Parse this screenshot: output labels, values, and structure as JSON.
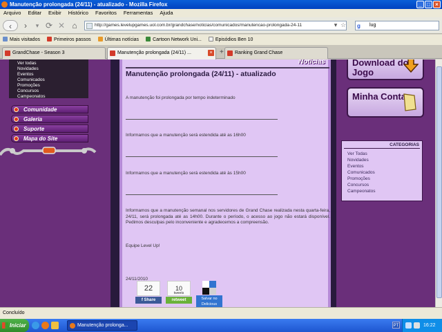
{
  "window": {
    "title": "Manutenção prolongada (24/11) - atualizado - Mozilla Firefox"
  },
  "menu": [
    "Arquivo",
    "Editar",
    "Exibir",
    "Histórico",
    "Favoritos",
    "Ferramentas",
    "Ajuda"
  ],
  "nav": {
    "url": "http://games.levelupgames.uol.com.br/grandchase/noticias/comunicados/manutencao-prolongada-24-11",
    "search_value": "lug"
  },
  "bookmarks": [
    {
      "label": "Mais visitados",
      "color": "#6b8fcc"
    },
    {
      "label": "Primeiros passos",
      "color": "#d43a2a"
    },
    {
      "label": "Últimas notícias",
      "color": "#e89a2a"
    },
    {
      "label": "Cartoon Network Uni...",
      "color": "#3a8a3a"
    },
    {
      "label": "Episódios Ben 10",
      "color": "#f0f0f0"
    }
  ],
  "tabs": [
    {
      "label": "GrandChase - Season 3"
    },
    {
      "label": "Manutenção prolongada (24/11) ..."
    },
    {
      "label": "Ranking Grand Chase"
    }
  ],
  "left_nav": [
    "Ver todas",
    "Novidades",
    "Eventos",
    "Comunicados",
    "Promoções",
    "Concursos",
    "Campeonatos"
  ],
  "left_buttons": [
    "Comunidade",
    "Galeria",
    "Suporte",
    "Mapa do Site"
  ],
  "article": {
    "section": "Notícias",
    "title": "Manutenção prolongada (24/11) - atualizado",
    "p1": "A manutenção foi prolongada por tempo indeterminado",
    "p2": "Informamos que a manutenção será estendida até as 16h00",
    "p3": "Informamos que a manutenção será estendida até às 15h00",
    "p4": "Informamos que a manutenção semanal nos servidores de Grand Chase realizada nesta quarta-feira, 24/11, será prolongada até as 14h00. Durante o período, o acesso ao jogo não estará disponível. Pedimos desculpas pelo inconveniente e agradecemos a compreensão.",
    "signature": "Equipe Level Up!",
    "date": "24/11/2010"
  },
  "share": {
    "fb_count": "22",
    "fb_label": "Share",
    "tw_count": "10",
    "tw_sub": "tweets",
    "tw_label": "retweet",
    "del_label": "Salvar no Delicious"
  },
  "right": {
    "download_label": "Download do Jogo",
    "account_label": "Minha Conta",
    "categories_title": "CATEGORIAS",
    "categories": [
      "Ver Todas",
      "Novidades",
      "Eventos",
      "Comunicados",
      "Promoções",
      "Concursos",
      "Campeonatos"
    ]
  },
  "status": {
    "text": "Concluído"
  },
  "taskbar": {
    "start": "Iniciar",
    "window": "Manutenção prolonga...",
    "lang": "PT",
    "time": "16:22"
  }
}
